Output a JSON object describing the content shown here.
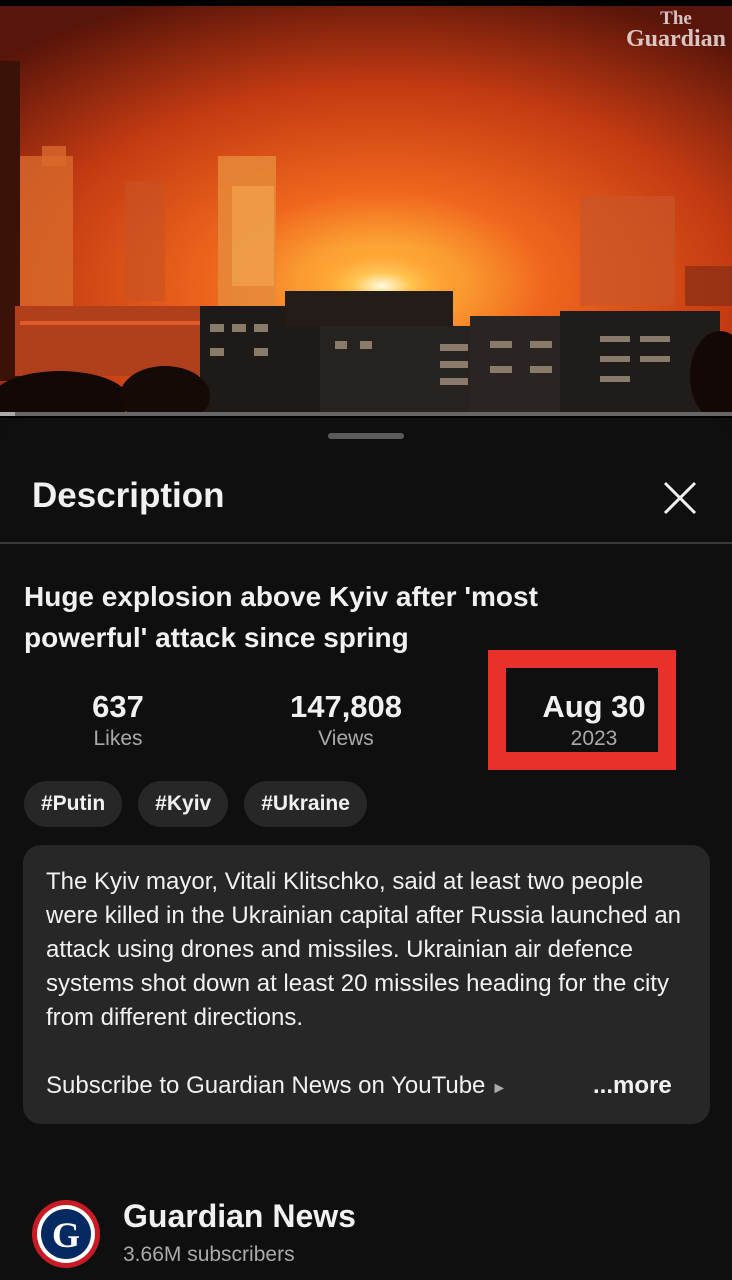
{
  "video": {
    "watermark_line1": "The",
    "watermark_line2": "Guardian",
    "progress_fraction": 0.02
  },
  "sheet": {
    "title": "Description"
  },
  "video_info": {
    "title": "Huge explosion above Kyiv after 'most powerful' attack since spring",
    "stats": {
      "likes_value": "637",
      "likes_label": "Likes",
      "views_value": "147,808",
      "views_label": "Views",
      "date_value": "Aug 30",
      "date_year": "2023"
    },
    "hashtags": [
      "#Putin",
      "#Kyiv",
      "#Ukraine"
    ],
    "description": "The Kyiv mayor, Vitali Klitschko, said at least two people were killed in the Ukrainian capital after Russia launched an attack using drones and missiles. Ukrainian air defence systems shot down at least 20 missiles heading for the city from different directions.",
    "subscribe_line": "Subscribe to Guardian News on YouTube",
    "more_label": "...more"
  },
  "channel": {
    "avatar_letter": "G",
    "name": "Guardian News",
    "subscribers": "3.66M subscribers"
  },
  "colors": {
    "background": "#0f0f0f",
    "card": "#272727",
    "highlight_box": "#e8312b",
    "secondary_text": "#aaaaaa"
  }
}
